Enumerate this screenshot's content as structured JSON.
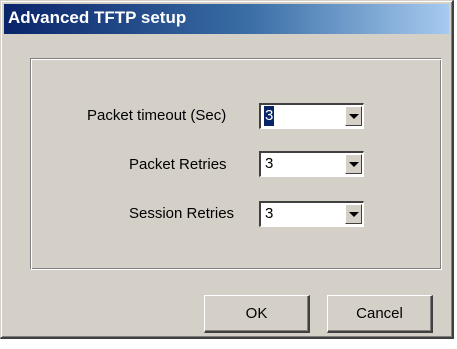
{
  "window": {
    "title": "Advanced TFTP setup"
  },
  "settings": [
    {
      "label": "Packet timeout (Sec)",
      "value": "3",
      "selected": true
    },
    {
      "label": "Packet Retries",
      "value": "3",
      "selected": false
    },
    {
      "label": "Session Retries",
      "value": "3",
      "selected": false
    }
  ],
  "buttons": {
    "ok_label": "OK",
    "cancel_label": "Cancel"
  },
  "colors": {
    "titlebar_start": "#0a246a",
    "titlebar_end": "#a6caf0",
    "face": "#d4d0c8"
  },
  "icons": {
    "dropdown": "chevron-down-icon"
  }
}
